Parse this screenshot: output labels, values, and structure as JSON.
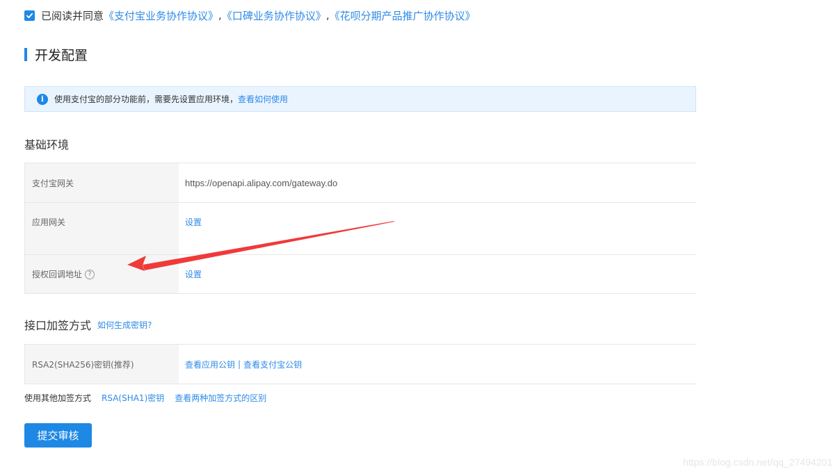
{
  "agreement": {
    "checked": true,
    "prefix": "已阅读并同意",
    "links": [
      "《支付宝业务协作协议》",
      "《口碑业务协作协议》",
      "《花呗分期产品推广协作协议》"
    ],
    "separator": ","
  },
  "section": {
    "title": "开发配置"
  },
  "info_banner": {
    "icon": "info-icon",
    "text": "使用支付宝的部分功能前，需要先设置应用环境，",
    "link": "查看如何使用"
  },
  "basic_env": {
    "title": "基础环境",
    "rows": [
      {
        "label": "支付宝网关",
        "value": "https://openapi.alipay.com/gateway.do",
        "is_link": false
      },
      {
        "label": "应用网关",
        "value": "设置",
        "is_link": true
      },
      {
        "label": "授权回调地址",
        "value": "设置",
        "is_link": true,
        "help_icon": "?"
      }
    ]
  },
  "signing": {
    "title": "接口加签方式",
    "help_link": "如何生成密钥?",
    "row": {
      "label": "RSA2(SHA256)密钥(推荐)",
      "link_app_key": "查看应用公钥",
      "divider": "|",
      "link_alipay_key": "查看支付宝公钥"
    },
    "other_label": "使用其他加签方式",
    "other_link_rsa": "RSA(SHA1)密钥",
    "other_link_diff": "查看两种加签方式的区别"
  },
  "submit": {
    "label": "提交审核"
  },
  "watermark": "https://blog.csdn.net/qq_27494201",
  "colors": {
    "accent": "#1e88e5",
    "link": "#2f8ae8",
    "annotation_arrow": "#f03a3a"
  }
}
